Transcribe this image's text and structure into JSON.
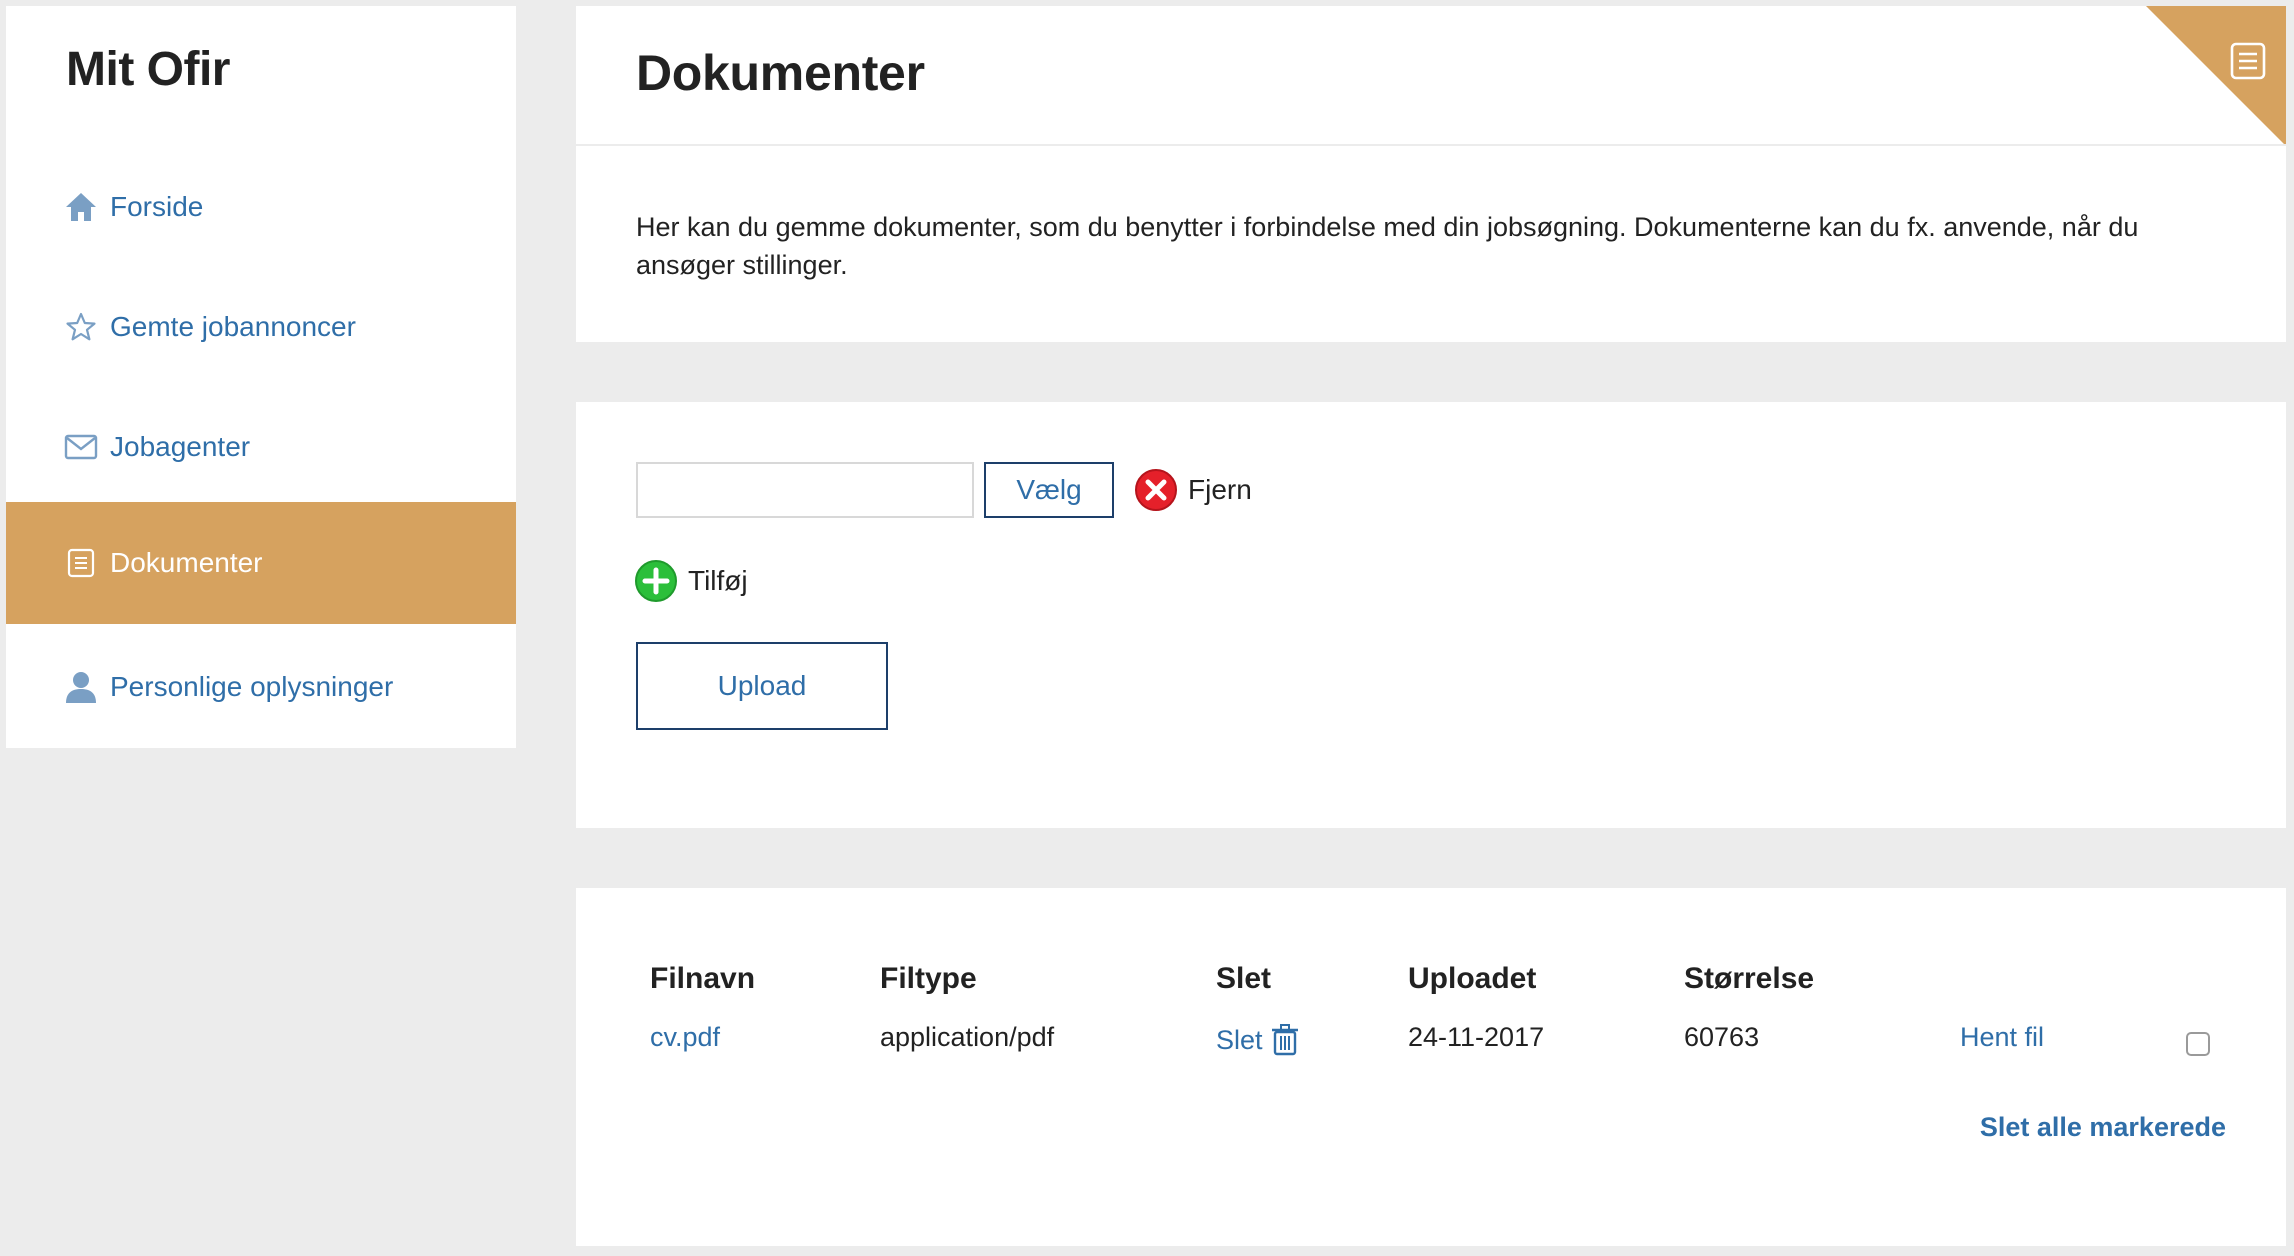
{
  "sidebar": {
    "title": "Mit Ofir",
    "items": [
      {
        "label": "Forside",
        "icon": "home-icon"
      },
      {
        "label": "Gemte jobannoncer",
        "icon": "star-icon"
      },
      {
        "label": "Jobagenter",
        "icon": "envelope-icon"
      },
      {
        "label": "Dokumenter",
        "icon": "document-icon",
        "active": true
      },
      {
        "label": "Personlige oplysninger",
        "icon": "user-icon"
      }
    ]
  },
  "header": {
    "title": "Dokumenter",
    "description": "Her kan du gemme dokumenter, som du benytter i forbindelse med din jobsøgning. Dokumenterne kan du fx. anvende, når du ansøger stillinger."
  },
  "upload": {
    "file_value": "",
    "choose_label": "Vælg",
    "remove_label": "Fjern",
    "add_label": "Tilføj",
    "upload_label": "Upload"
  },
  "documents": {
    "columns": [
      "Filnavn",
      "Filtype",
      "Slet",
      "Uploadet",
      "Størrelse"
    ],
    "rows": [
      {
        "filename": "cv.pdf",
        "filetype": "application/pdf",
        "delete_label": "Slet",
        "uploaded": "24-11-2017",
        "size": "60763",
        "download_label": "Hent fil"
      }
    ],
    "delete_all_label": "Slet alle markerede"
  },
  "colors": {
    "accent": "#d6a25f",
    "link": "#2f6ea8",
    "button_border": "#1d3f6a",
    "background": "#ececec"
  }
}
